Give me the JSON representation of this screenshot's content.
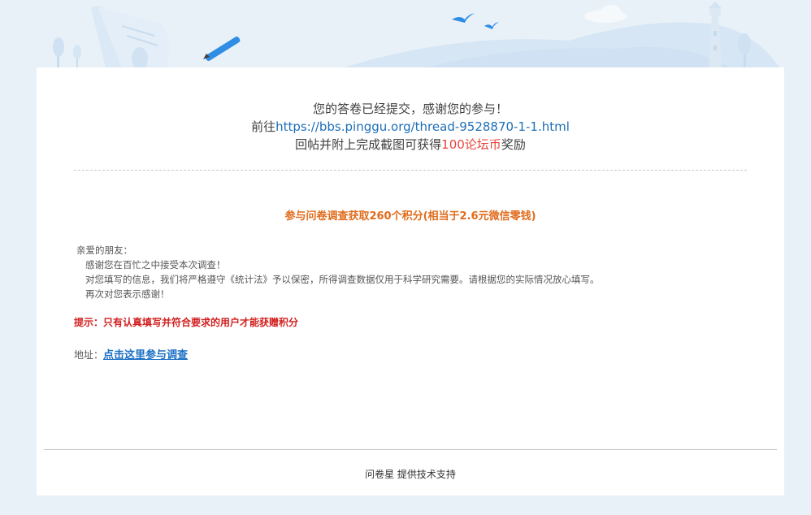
{
  "header": {
    "illustration": "survey-scroll-pen-birds-lighthouse"
  },
  "message": {
    "line1": "您的答卷已经提交，感谢您的参与！",
    "line2_prefix": "前往",
    "line2_link": "https://bbs.pinggu.org/thread-9528870-1-1.html",
    "line3_prefix": "回帖并附上完成截图可获得",
    "line3_highlight": "100论坛币",
    "line3_suffix": "奖励"
  },
  "reward_title": "参与问卷调查获取260个积分(相当于2.6元微信零钱)",
  "body": {
    "greeting": "亲爱的朋友：",
    "line1": "感谢您在百忙之中接受本次调查！",
    "line2": "对您填写的信息，我们将严格遵守《统计法》予以保密，所得调查数据仅用于科学研究需要。请根据您的实际情况放心填写。",
    "line3": "再次对您表示感谢！"
  },
  "tip": "提示：只有认真填写并符合要求的用户才能获赠积分",
  "address": {
    "label": "地址：",
    "link_text": "点击这里参与调查"
  },
  "footer": {
    "brand": "问卷星",
    "text": "提供技术支持"
  },
  "colors": {
    "background": "#e9f1f8",
    "link": "#1e6fb8",
    "reward": "#e06c1c",
    "tip": "#d21f1f",
    "highlight": "#e8453c"
  }
}
